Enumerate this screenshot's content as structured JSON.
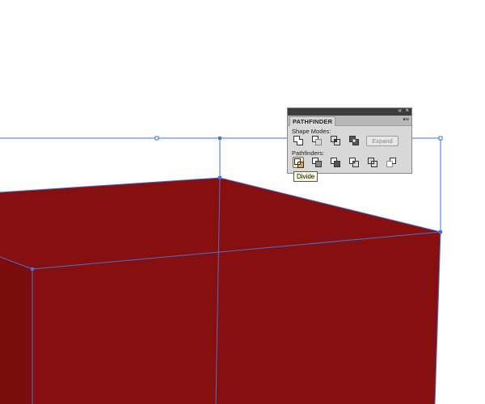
{
  "colors": {
    "shape_fill": "#86100f",
    "selection": "#4a6fd6",
    "panel_bg": "#d8d8d8"
  },
  "panel": {
    "tab_label": "PATHFINDER",
    "shape_modes_label": "Shape Modes:",
    "pathfinders_label": "Pathfinders:",
    "expand_label": "Expand",
    "shape_mode_icons": [
      "unite-icon",
      "minus-front-icon",
      "intersect-icon",
      "exclude-icon"
    ],
    "pathfinder_icons": [
      "divide-icon",
      "trim-icon",
      "merge-icon",
      "crop-icon",
      "outline-icon",
      "minus-back-icon"
    ]
  },
  "tooltip": {
    "text": "Divide"
  }
}
